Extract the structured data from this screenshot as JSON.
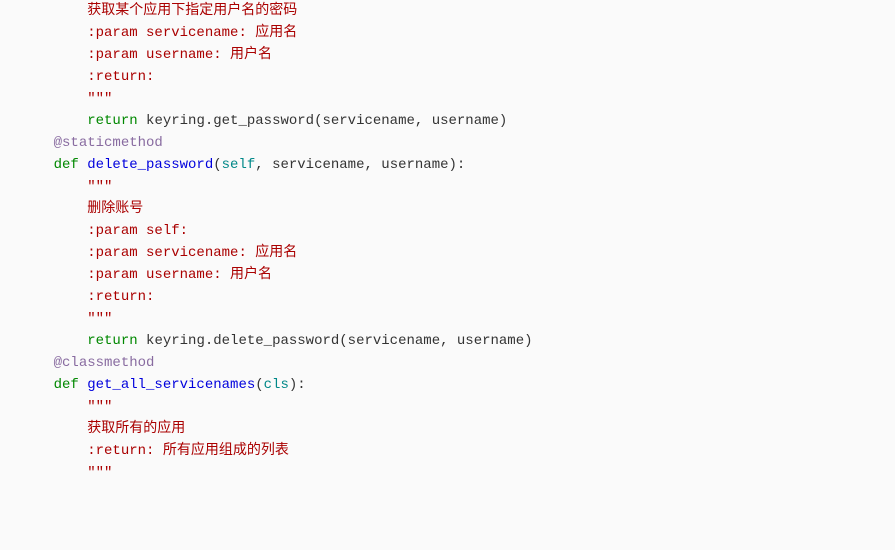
{
  "lines": [
    {
      "indent": 8,
      "parts": [
        {
          "cls": "comment",
          "t": "获取某个应用下指定用户名的密码"
        }
      ]
    },
    {
      "indent": 8,
      "parts": [
        {
          "cls": "comment",
          "t": ":param servicename: 应用名"
        }
      ]
    },
    {
      "indent": 8,
      "parts": [
        {
          "cls": "comment",
          "t": ":param username: 用户名"
        }
      ]
    },
    {
      "indent": 8,
      "parts": [
        {
          "cls": "comment",
          "t": ":return:"
        }
      ]
    },
    {
      "indent": 8,
      "parts": [
        {
          "cls": "comment",
          "t": "\"\"\""
        }
      ]
    },
    {
      "indent": 8,
      "parts": [
        {
          "cls": "keyword",
          "t": "return"
        },
        {
          "cls": "plain",
          "t": " keyring.get_password(servicename, username)"
        }
      ]
    },
    {
      "indent": 0,
      "parts": [
        {
          "cls": "plain",
          "t": ""
        }
      ]
    },
    {
      "indent": 4,
      "parts": [
        {
          "cls": "decorator",
          "t": "@staticmethod"
        }
      ]
    },
    {
      "indent": 4,
      "parts": [
        {
          "cls": "keyword",
          "t": "def "
        },
        {
          "cls": "funcname",
          "t": "delete_password"
        },
        {
          "cls": "plain",
          "t": "("
        },
        {
          "cls": "param",
          "t": "self"
        },
        {
          "cls": "plain",
          "t": ", servicename, username):"
        }
      ]
    },
    {
      "indent": 8,
      "parts": [
        {
          "cls": "comment",
          "t": "\"\"\""
        }
      ]
    },
    {
      "indent": 8,
      "parts": [
        {
          "cls": "comment",
          "t": "删除账号"
        }
      ]
    },
    {
      "indent": 8,
      "parts": [
        {
          "cls": "comment",
          "t": ":param self:"
        }
      ]
    },
    {
      "indent": 8,
      "parts": [
        {
          "cls": "comment",
          "t": ":param servicename: 应用名"
        }
      ]
    },
    {
      "indent": 8,
      "parts": [
        {
          "cls": "comment",
          "t": ":param username: 用户名"
        }
      ]
    },
    {
      "indent": 8,
      "parts": [
        {
          "cls": "comment",
          "t": ":return:"
        }
      ]
    },
    {
      "indent": 8,
      "parts": [
        {
          "cls": "comment",
          "t": "\"\"\""
        }
      ]
    },
    {
      "indent": 8,
      "parts": [
        {
          "cls": "keyword",
          "t": "return"
        },
        {
          "cls": "plain",
          "t": " keyring.delete_password(servicename, username)"
        }
      ]
    },
    {
      "indent": 0,
      "parts": [
        {
          "cls": "plain",
          "t": ""
        }
      ]
    },
    {
      "indent": 4,
      "parts": [
        {
          "cls": "decorator",
          "t": "@classmethod"
        }
      ]
    },
    {
      "indent": 4,
      "parts": [
        {
          "cls": "keyword",
          "t": "def "
        },
        {
          "cls": "funcname",
          "t": "get_all_servicenames"
        },
        {
          "cls": "plain",
          "t": "("
        },
        {
          "cls": "param",
          "t": "cls"
        },
        {
          "cls": "plain",
          "t": "):"
        }
      ]
    },
    {
      "indent": 8,
      "parts": [
        {
          "cls": "comment",
          "t": "\"\"\""
        }
      ]
    },
    {
      "indent": 8,
      "parts": [
        {
          "cls": "comment",
          "t": "获取所有的应用"
        }
      ]
    },
    {
      "indent": 8,
      "parts": [
        {
          "cls": "comment",
          "t": ":return: 所有应用组成的列表"
        }
      ]
    },
    {
      "indent": 8,
      "parts": [
        {
          "cls": "comment",
          "t": "\"\"\""
        }
      ]
    }
  ]
}
